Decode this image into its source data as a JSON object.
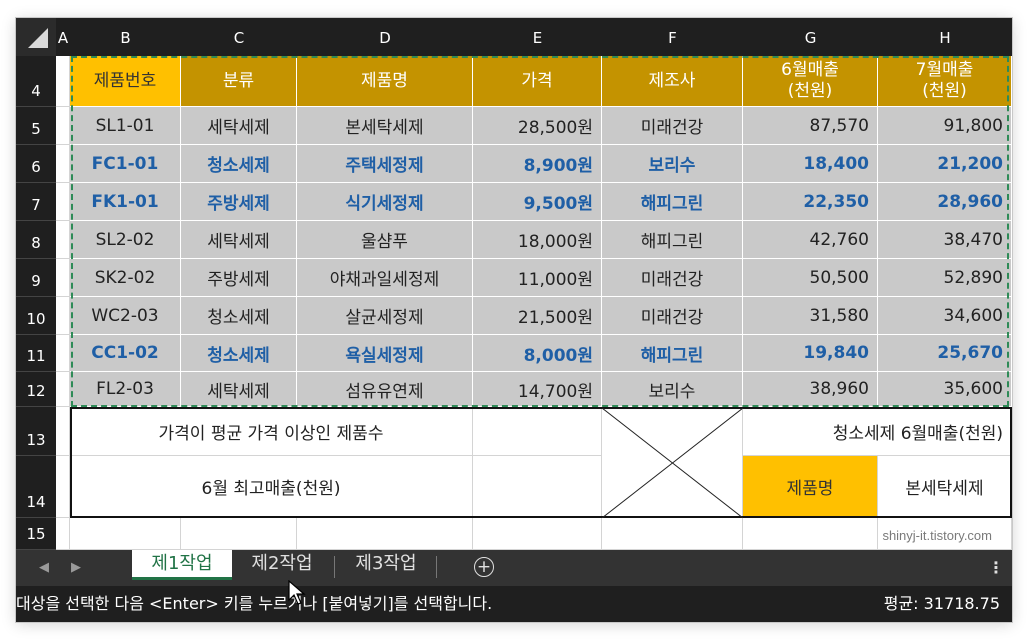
{
  "columns": [
    "A",
    "B",
    "C",
    "D",
    "E",
    "F",
    "G",
    "H"
  ],
  "rows": [
    "4",
    "5",
    "6",
    "7",
    "8",
    "9",
    "10",
    "11",
    "12",
    "13",
    "14",
    "15"
  ],
  "header": [
    "제품번호",
    "분류",
    "제품명",
    "가격",
    "제조사"
  ],
  "header_g": [
    "6월매출",
    "(천원)"
  ],
  "header_h": [
    "7월매출",
    "(천원)"
  ],
  "data_rows": [
    {
      "id": "SL1-01",
      "cat": "세탁세제",
      "name": "본세탁세제",
      "price": "28,500원",
      "maker": "미래건강",
      "jun": "87,570",
      "jul": "91,800",
      "highlight": false
    },
    {
      "id": "FC1-01",
      "cat": "청소세제",
      "name": "주택세정제",
      "price": "8,900원",
      "maker": "보리수",
      "jun": "18,400",
      "jul": "21,200",
      "highlight": true
    },
    {
      "id": "FK1-01",
      "cat": "주방세제",
      "name": "식기세정제",
      "price": "9,500원",
      "maker": "해피그린",
      "jun": "22,350",
      "jul": "28,960",
      "highlight": true
    },
    {
      "id": "SL2-02",
      "cat": "세탁세제",
      "name": "울샴푸",
      "price": "18,000원",
      "maker": "해피그린",
      "jun": "42,760",
      "jul": "38,470",
      "highlight": false
    },
    {
      "id": "SK2-02",
      "cat": "주방세제",
      "name": "야채과일세정제",
      "price": "11,000원",
      "maker": "미래건강",
      "jun": "50,500",
      "jul": "52,890",
      "highlight": false
    },
    {
      "id": "WC2-03",
      "cat": "청소세제",
      "name": "살균세정제",
      "price": "21,500원",
      "maker": "미래건강",
      "jun": "31,580",
      "jul": "34,600",
      "highlight": false
    },
    {
      "id": "CC1-02",
      "cat": "청소세제",
      "name": "욕실세정제",
      "price": "8,000원",
      "maker": "해피그린",
      "jun": "19,840",
      "jul": "25,670",
      "highlight": true
    },
    {
      "id": "FL2-03",
      "cat": "세탁세제",
      "name": "섬유유연제",
      "price": "14,700원",
      "maker": "보리수",
      "jun": "38,960",
      "jul": "35,600",
      "highlight": false
    }
  ],
  "summary": {
    "row13_label": "가격이 평균 가격 이상인 제품수",
    "row13_right": "청소세제 6월매출(천원)",
    "row14_label": "6월 최고매출(천원)",
    "row14_name_label": "제품명",
    "row14_name_value": "본세탁세제"
  },
  "watermark": "shinyj-it.tistory.com",
  "tabs": [
    "제1작업",
    "제2작업",
    "제3작업"
  ],
  "active_tab": "제1작업",
  "status": {
    "message": "대상을 선택한 다음 <Enter> 키를 누르거나 [붙여넣기]를 선택합니다.",
    "average": "평균: 31718.75"
  },
  "colors": {
    "header_gold": "#c49300",
    "header_yellow": "#ffc000",
    "highlight_blue": "#1f5fa6",
    "selection_green": "#2e8b57",
    "tab_green": "#217346"
  },
  "icons": [
    "scroll-left-icon",
    "scroll-right-icon",
    "add-sheet-icon",
    "more-options-icon",
    "mouse-cursor-icon"
  ]
}
